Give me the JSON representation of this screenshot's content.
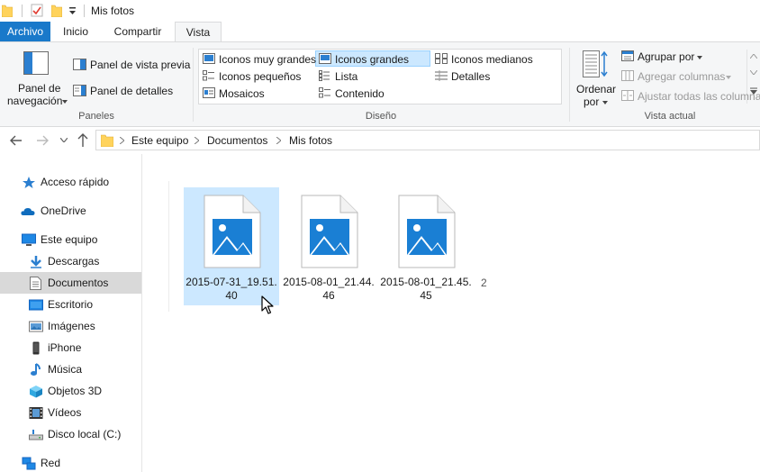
{
  "window": {
    "title": "Mis fotos"
  },
  "tabs": [
    {
      "label": "Archivo"
    },
    {
      "label": "Inicio"
    },
    {
      "label": "Compartir"
    },
    {
      "label": "Vista"
    }
  ],
  "ribbon": {
    "panes": {
      "nav_pane_line1": "Panel de",
      "nav_pane_line2": "navegación",
      "preview_pane": "Panel de vista previa",
      "details_pane": "Panel de detalles",
      "group_label": "Paneles"
    },
    "layout": {
      "extra_large": "Iconos muy grandes",
      "large": "Iconos grandes",
      "medium": "Iconos medianos",
      "small": "Iconos pequeños",
      "list": "Lista",
      "details": "Detalles",
      "tiles": "Mosaicos",
      "content": "Contenido",
      "group_label": "Diseño"
    },
    "current_view": {
      "sort_line1": "Ordenar",
      "sort_line2": "por",
      "group_by": "Agrupar por",
      "add_columns": "Agregar columnas",
      "fit_columns": "Ajustar todas las columnas",
      "group_label": "Vista actual"
    }
  },
  "address": {
    "crumbs": [
      "Este equipo",
      "Documentos",
      "Mis fotos"
    ]
  },
  "sidebar": {
    "items": [
      {
        "label": "Acceso rápido"
      },
      {
        "label": "OneDrive"
      },
      {
        "label": "Este equipo"
      },
      {
        "label": "Descargas"
      },
      {
        "label": "Documentos"
      },
      {
        "label": "Escritorio"
      },
      {
        "label": "Imágenes"
      },
      {
        "label": "iPhone"
      },
      {
        "label": "Música"
      },
      {
        "label": "Objetos 3D"
      },
      {
        "label": "Vídeos"
      },
      {
        "label": "Disco local (C:)"
      },
      {
        "label": "Red"
      }
    ]
  },
  "files": [
    {
      "name": "2015-07-31_19.51.40"
    },
    {
      "name": "2015-08-01_21.44.46"
    },
    {
      "name": "2015-08-01_21.45.45"
    }
  ],
  "truncated_label": "2",
  "colors": {
    "accent": "#1979ca",
    "selection": "#cce8ff",
    "image_icon": "#1a7fd4",
    "folder": "#ffd35c"
  }
}
